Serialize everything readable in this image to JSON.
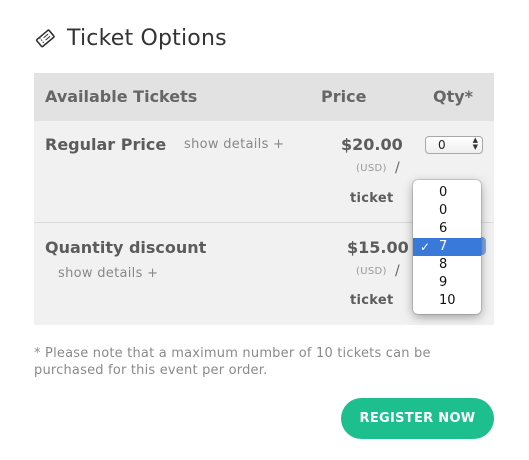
{
  "header": {
    "title": "Ticket Options",
    "icon": "ticket-icon"
  },
  "table": {
    "columns": [
      "Available Tickets",
      "Price",
      "Qty*"
    ],
    "rows": [
      {
        "name": "Regular Price",
        "details_link": "show details +",
        "price": "$20.00",
        "currency": "(USD)",
        "slash": "/",
        "per": "ticket",
        "qty": "0"
      },
      {
        "name": "Quantity discount",
        "details_link": "show details +",
        "price": "$15.00",
        "currency": "(USD)",
        "slash": "/",
        "per": "ticket",
        "qty": "7"
      }
    ]
  },
  "qty_dropdown": {
    "options": [
      "0",
      "0",
      "6",
      "7",
      "8",
      "9",
      "10"
    ],
    "selected": "7",
    "check": "✓"
  },
  "note": "* Please note that a maximum number of 10 tickets can be purchased for this event per order.",
  "register_button": {
    "label": "REGISTER NOW",
    "color": "#1dbf8f"
  },
  "colors": {
    "header_bg": "#e2e2e2",
    "row_bg": "#f1f1f1",
    "selection": "#3879d9"
  }
}
